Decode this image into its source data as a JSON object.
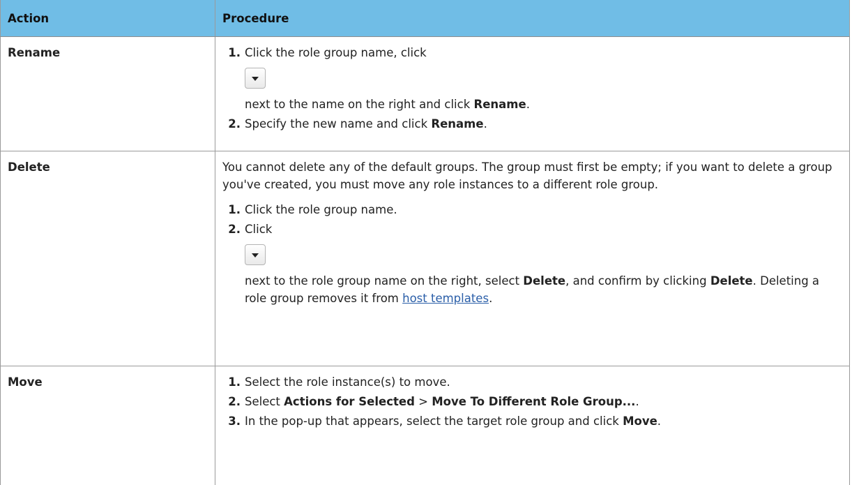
{
  "header": {
    "col_action": "Action",
    "col_procedure": "Procedure"
  },
  "rows": [
    {
      "action": "Rename",
      "steps": [
        {
          "num": "1.",
          "text_a": "Click the role group name, click",
          "icon": "caret-down-icon",
          "text_b": "next to the name on the right and click ",
          "bold_b": "Rename",
          "text_c": "."
        },
        {
          "num": "2.",
          "text_a": "Specify the new name and click ",
          "bold_a": "Rename",
          "text_b": "."
        }
      ]
    },
    {
      "action": "Delete",
      "intro": "You cannot delete any of the default groups. The group must first be empty; if you want to delete a group you've created, you must move any role instances to a different role group.",
      "steps": [
        {
          "num": "1.",
          "text_a": "Click the role group name."
        },
        {
          "num": "2.",
          "text_a": "Click",
          "icon": "caret-down-icon",
          "text_b": "next to the role group name on the right, select ",
          "bold_b": "Delete",
          "text_c": ", and confirm by clicking ",
          "bold_c": "Delete",
          "text_d": ". Deleting a role group removes it from ",
          "link": "host templates",
          "text_e": "."
        }
      ]
    },
    {
      "action": "Move",
      "steps": [
        {
          "num": "1.",
          "text_a": "Select the role instance(s) to move."
        },
        {
          "num": "2.",
          "text_a": "Select ",
          "bold_a": "Actions for Selected",
          "text_b": " > ",
          "bold_b": "Move To Different Role Group...",
          "text_c": "."
        },
        {
          "num": "3.",
          "text_a": "In the pop-up that appears, select the target role group and click ",
          "bold_a": "Move",
          "text_b": "."
        }
      ]
    }
  ]
}
